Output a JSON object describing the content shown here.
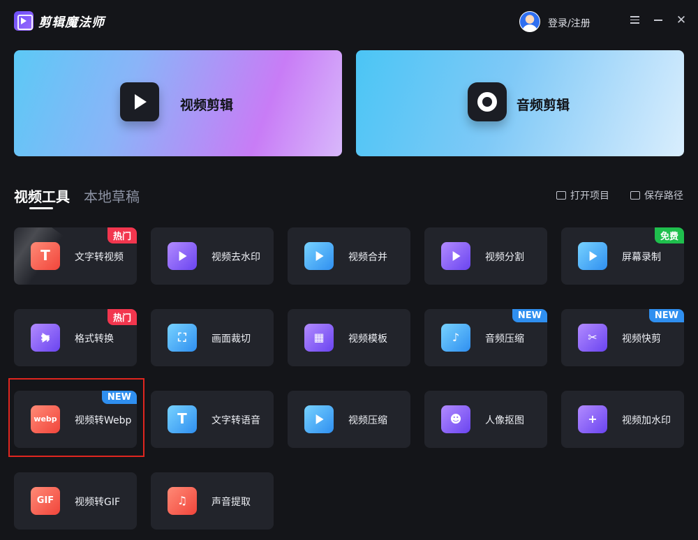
{
  "app": {
    "title": "剪辑魔法师",
    "login_label": "登录/注册"
  },
  "banners": [
    {
      "label": "视频剪辑"
    },
    {
      "label": "音频剪辑"
    }
  ],
  "tabs": [
    {
      "label": "视频工具",
      "active": true
    },
    {
      "label": "本地草稿",
      "active": false
    }
  ],
  "actions": {
    "open_project": "打开项目",
    "save_path": "保存路径"
  },
  "tools": [
    {
      "label": "文字转视频",
      "badge": "热门",
      "icon": "text-to-video-icon"
    },
    {
      "label": "视频去水印",
      "badge": "",
      "icon": "remove-watermark-icon"
    },
    {
      "label": "视频合并",
      "badge": "",
      "icon": "merge-video-icon"
    },
    {
      "label": "视频分割",
      "badge": "",
      "icon": "split-video-icon"
    },
    {
      "label": "屏幕录制",
      "badge": "免费",
      "icon": "screen-record-icon"
    },
    {
      "label": "格式转换",
      "badge": "热门",
      "icon": "format-convert-icon"
    },
    {
      "label": "画面裁切",
      "badge": "",
      "icon": "crop-icon"
    },
    {
      "label": "视频模板",
      "badge": "",
      "icon": "template-icon"
    },
    {
      "label": "音频压缩",
      "badge": "NEW",
      "icon": "audio-compress-icon"
    },
    {
      "label": "视频快剪",
      "badge": "NEW",
      "icon": "quick-cut-icon"
    },
    {
      "label": "视频转Webp",
      "badge": "NEW",
      "icon": "video-to-webp-icon"
    },
    {
      "label": "文字转语音",
      "badge": "",
      "icon": "text-to-speech-icon"
    },
    {
      "label": "视频压缩",
      "badge": "",
      "icon": "video-compress-icon"
    },
    {
      "label": "人像抠图",
      "badge": "",
      "icon": "portrait-cutout-icon"
    },
    {
      "label": "视频加水印",
      "badge": "",
      "icon": "add-watermark-icon"
    },
    {
      "label": "视频转GIF",
      "badge": "",
      "icon": "video-to-gif-icon"
    },
    {
      "label": "声音提取",
      "badge": "",
      "icon": "audio-extract-icon"
    }
  ],
  "icon_glyphs": {
    "webp": "webp",
    "gif": "GIF",
    "text": "T"
  },
  "colors": {
    "hot": "#f2364e",
    "free": "#1fbf4d",
    "new": "#2f8ff0",
    "selection": "#e0261f"
  }
}
